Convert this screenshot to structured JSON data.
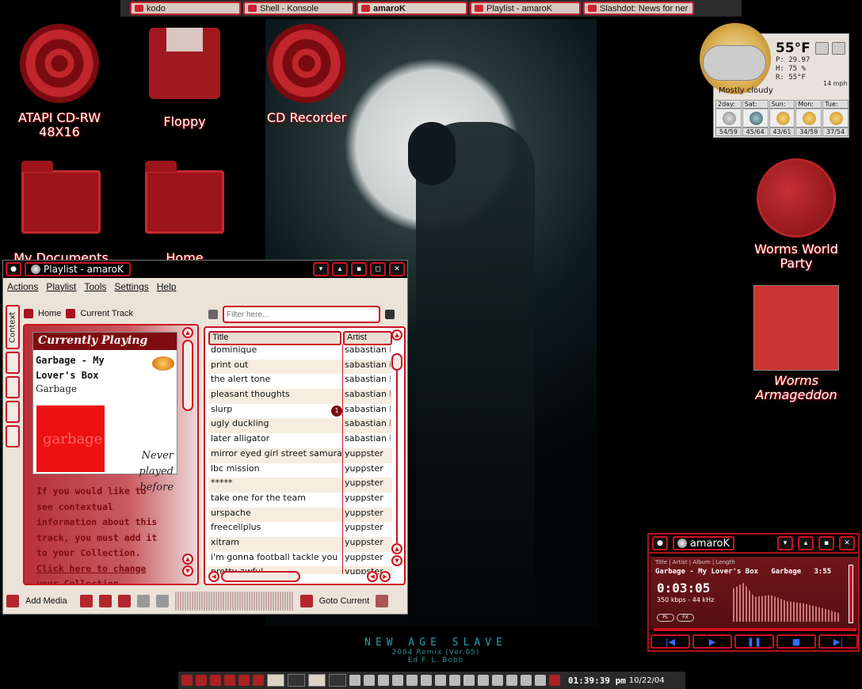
{
  "taskbar": {
    "tasks": [
      {
        "label": "kodo"
      },
      {
        "label": "Shell - Konsole"
      },
      {
        "label": "amaroK"
      },
      {
        "label": "Playlist - amaroK"
      },
      {
        "label": "Slashdot: News for ner"
      }
    ]
  },
  "desktop_icons": {
    "cdrw": "ATAPI CD-RW 48X16",
    "floppy": "Floppy",
    "cd_recorder": "CD Recorder",
    "my_documents": "My Documents",
    "home": "Home",
    "worms_world": "Worms World Party",
    "worms_arm": "Worms Armageddon"
  },
  "weather": {
    "temp": "55°F",
    "pressure": "P: 29.97",
    "humidity": "H: 75 %",
    "realfeel": "R: 55°F",
    "wind": "14 mph",
    "description": "Mostly cloudy",
    "days": [
      {
        "name": "2day:",
        "temps": "54/59"
      },
      {
        "name": "Sat:",
        "temps": "45/64"
      },
      {
        "name": "Sun:",
        "temps": "43/61"
      },
      {
        "name": "Mon:",
        "temps": "34/59"
      },
      {
        "name": "Tue:",
        "temps": "37/54"
      }
    ]
  },
  "wallpaper": {
    "title": "NEW AGE SLAVE",
    "subtitle": "2004 Remix (Ver.05)",
    "author": "Ed F. L. Bobb"
  },
  "playlist_window": {
    "title": "Playlist - amaroK",
    "menu": [
      "Actions",
      "Playlist",
      "Tools",
      "Settings",
      "Help"
    ],
    "context_tab": "Context",
    "home_label": "Home",
    "current_track_label": "Current Track",
    "currently_playing": "Currently Playing",
    "track_title": "Garbage - My Lover's Box",
    "artist": "Garbage",
    "cover_text": "garbage",
    "never_played": "Never played before",
    "info_text": "If you would like to see contextual information about this track, you must add it to your Collection.",
    "info_link": "Click here to change your Collection",
    "filter_placeholder": "Filter here...",
    "columns": [
      "Title",
      "Artist"
    ],
    "rows": [
      {
        "title": "dominique",
        "artist": "sabastian b"
      },
      {
        "title": "print out",
        "artist": "sabastian b"
      },
      {
        "title": "the alert tone",
        "artist": "sabastian b"
      },
      {
        "title": "pleasant thoughts",
        "artist": "sabastian b"
      },
      {
        "title": "slurp",
        "artist": "sabastian b",
        "queue": "1"
      },
      {
        "title": "ugly duckling",
        "artist": "sabastian b"
      },
      {
        "title": "later alligator",
        "artist": "sabastian b"
      },
      {
        "title": "mirror eyed girl street samurai",
        "artist": "yuppster"
      },
      {
        "title": "lbc mission",
        "artist": "yuppster"
      },
      {
        "title": "*****",
        "artist": "yuppster"
      },
      {
        "title": "take one for the team",
        "artist": "yuppster"
      },
      {
        "title": "urspache",
        "artist": "yuppster"
      },
      {
        "title": "freecellplus",
        "artist": "yuppster"
      },
      {
        "title": "xitram",
        "artist": "yuppster"
      },
      {
        "title": "i'm gonna football tackle you",
        "artist": "yuppster"
      },
      {
        "title": "pretty awful",
        "artist": "yuppster"
      }
    ],
    "add_media": "Add Media",
    "goto_current": "Goto Current"
  },
  "player": {
    "title": "amaroK",
    "columns": "Title | Artist | Album | Length",
    "track_line": "Garbage - My Lover's Box   Garbage   3:55",
    "time": "0:03:05",
    "rate": "350 kbps - 44 kHz",
    "pl": "PL",
    "fx": "FX",
    "buttons": [
      "|◀",
      "▶",
      "❚❚",
      "■",
      "▶|"
    ]
  },
  "panel": {
    "clock": "01:39:39 pm",
    "date": "10/22/04"
  }
}
